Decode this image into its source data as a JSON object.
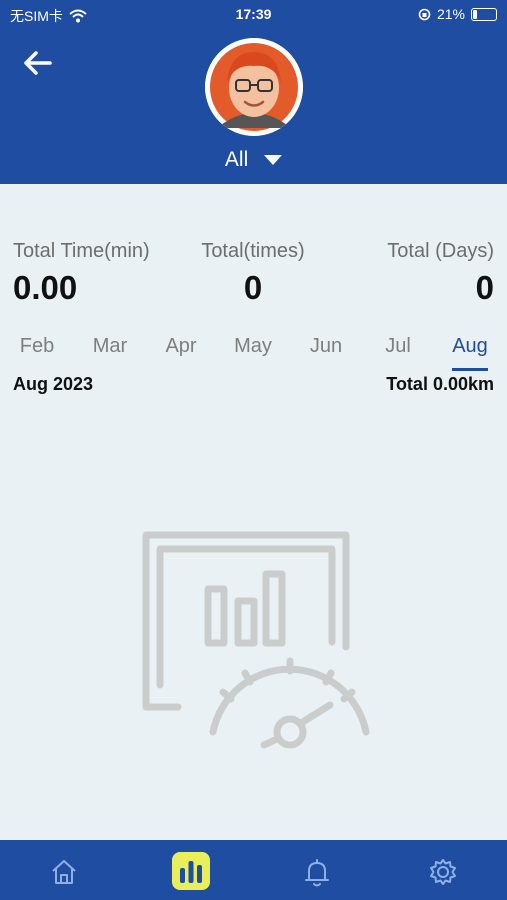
{
  "status_bar": {
    "carrier": "无SIM卡",
    "time": "17:39",
    "battery": "21%"
  },
  "header": {
    "filter_label": "All"
  },
  "stats": [
    {
      "label": "Total Time(min)",
      "value": "0.00"
    },
    {
      "label": "Total(times)",
      "value": "0"
    },
    {
      "label": "Total (Days)",
      "value": "0"
    }
  ],
  "months": [
    "Feb",
    "Mar",
    "Apr",
    "May",
    "Jun",
    "Jul",
    "Aug"
  ],
  "selected_month": "Aug",
  "summary": {
    "period": "Aug 2023",
    "distance": "Total 0.00km"
  },
  "colors": {
    "brand_blue": "#1e4da1",
    "background": "#eaf1f4",
    "active_tab": "#e8ef5a"
  },
  "tabs": [
    "home-icon",
    "stats-icon",
    "bell-icon",
    "gear-icon"
  ]
}
